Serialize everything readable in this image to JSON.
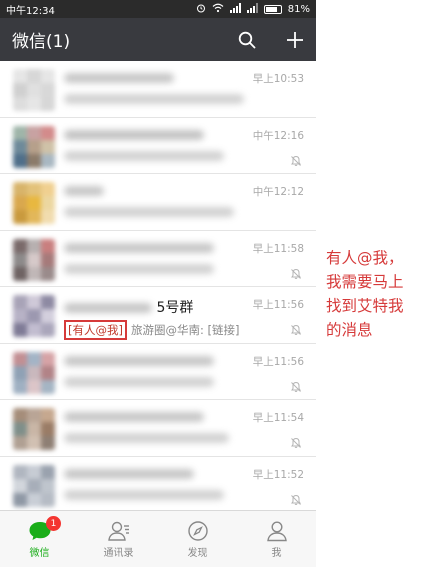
{
  "status_bar": {
    "carrier_time": "中午12:34",
    "battery": "81%",
    "battery_level": 0.81
  },
  "header": {
    "title": "微信(1)",
    "search_icon": "search-icon",
    "add_icon": "plus-icon"
  },
  "chats": [
    {
      "time": "早上10:53",
      "title": "",
      "preview": "",
      "muted": false,
      "avatar_colors": [
        "#e6e6e6",
        "#d7d7d7",
        "#e6e6e6",
        "#d0d0d0",
        "#e0e0e0",
        "#d8d8d8",
        "#dddddd",
        "#e6e6e6",
        "#d7d7d7"
      ]
    },
    {
      "time": "中午12:16",
      "title": "",
      "preview": "",
      "muted": true,
      "avatar_colors": [
        "#9fb5a9",
        "#c8a2a2",
        "#d38b8b",
        "#6e8a9a",
        "#b6a08b",
        "#cfc2a8",
        "#4f6f8a",
        "#8c7b6a",
        "#a9b8c2"
      ]
    },
    {
      "time": "中午12:12",
      "title": "",
      "preview": "",
      "muted": false,
      "avatar_colors": [
        "#d8b46a",
        "#e3c27a",
        "#f0d090",
        "#d9a84e",
        "#e8b840",
        "#ecd7a0",
        "#c99a3e",
        "#e2b75a",
        "#f1dcae"
      ]
    },
    {
      "time": "早上11:58",
      "title": "",
      "preview": "",
      "muted": true,
      "avatar_colors": [
        "#7a6a6a",
        "#b7b0b0",
        "#c97f7f",
        "#8d8a8a",
        "#d6c9c9",
        "#a67a7a",
        "#6f6363",
        "#c0b7b7",
        "#9a8b8b"
      ]
    },
    {
      "time": "早上11:56",
      "title": "5号群",
      "mention": "[有人@我]",
      "preview": "旅游圈@华南: [链接]",
      "muted": true,
      "avatar_colors": [
        "#a8a3b7",
        "#cfc9d8",
        "#8e8aa3",
        "#b7b2c6",
        "#9c98b0",
        "#d3cfdd",
        "#7f7b96",
        "#c2bdd0",
        "#aaa6bb"
      ]
    },
    {
      "time": "早上11:56",
      "title": "",
      "preview": "",
      "muted": true,
      "avatar_colors": [
        "#c28f93",
        "#a3b4c6",
        "#d6a3a6",
        "#8fa1b5",
        "#c9b8bd",
        "#b28387",
        "#9fb0c2",
        "#dcc5c8",
        "#a5b5c4"
      ]
    },
    {
      "time": "早上11:54",
      "title": "",
      "preview": "",
      "muted": true,
      "avatar_colors": [
        "#a58d7a",
        "#b9a596",
        "#c6a88f",
        "#7f8f8a",
        "#c9b6a6",
        "#9a7c66",
        "#b0a093",
        "#d1c0b2",
        "#8e7f74"
      ]
    },
    {
      "time": "早上11:52",
      "title": "",
      "preview": "",
      "muted": true,
      "avatar_colors": [
        "#b0b6c0",
        "#c7ccd4",
        "#9aa2ae",
        "#d2d6dc",
        "#a7aeb9",
        "#bfc5cd",
        "#8f98a5",
        "#c9ced6",
        "#b6bcc5"
      ]
    }
  ],
  "tabs": [
    {
      "label": "微信",
      "icon": "chat-bubble-icon",
      "active": true,
      "badge": "1"
    },
    {
      "label": "通讯录",
      "icon": "contacts-icon",
      "active": false
    },
    {
      "label": "发现",
      "icon": "compass-icon",
      "active": false
    },
    {
      "label": "我",
      "icon": "person-icon",
      "active": false
    }
  ],
  "annotation": "有人@我，\n我需要马上\n找到艾特我\n的消息",
  "colors": {
    "accent_green": "#1aad19",
    "title_bar": "#393a3f",
    "badge_red": "#f43530",
    "annotation_red": "#d63a3a"
  }
}
